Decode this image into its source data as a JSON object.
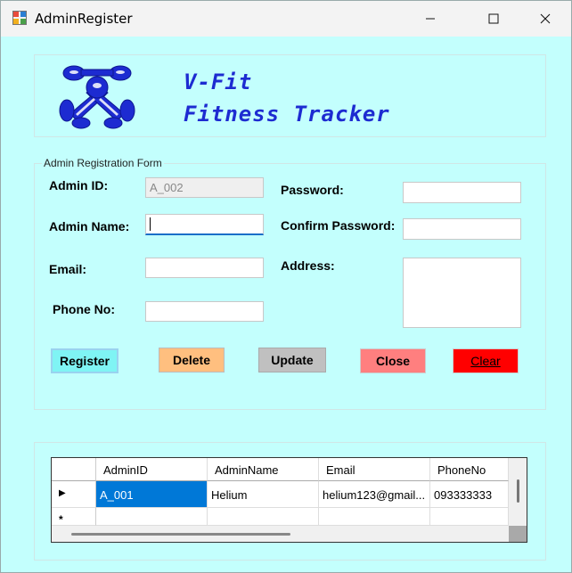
{
  "window": {
    "title": "AdminRegister",
    "icon": "winforms-app-icon",
    "controls": {
      "minimize": "minimize-icon",
      "maximize": "maximize-icon",
      "close": "close-icon"
    }
  },
  "header": {
    "logo_icon": "dumbbell-logo-icon",
    "line1": "V-Fit",
    "line2": "Fitness Tracker",
    "brand_color": "#1d2bd1"
  },
  "form": {
    "legend": "Admin Registration Form",
    "admin_id": {
      "label": "Admin ID:",
      "value": "A_002"
    },
    "admin_name": {
      "label": "Admin Name:",
      "value": ""
    },
    "email": {
      "label": "Email:",
      "value": ""
    },
    "phone": {
      "label": "Phone No:",
      "value": ""
    },
    "password": {
      "label": "Password:",
      "value": ""
    },
    "confirm_password": {
      "label": "Confirm Password:",
      "value": ""
    },
    "address": {
      "label": "Address:",
      "value": ""
    }
  },
  "buttons": {
    "register": {
      "label": "Register",
      "color": "#7ff4f4"
    },
    "delete": {
      "label": "Delete",
      "color": "#ffbf7f"
    },
    "update": {
      "label": "Update",
      "color": "#c0c0c0"
    },
    "close": {
      "label": "Close",
      "color": "#ff7f7f"
    },
    "clear": {
      "label": "Clear",
      "color": "#ff0000"
    }
  },
  "grid": {
    "columns": [
      "AdminID",
      "AdminName",
      "Email",
      "PhoneNo"
    ],
    "rows": [
      {
        "AdminID": "A_001",
        "AdminName": "Helium",
        "Email": "helium123@gmail...",
        "PhoneNo": "093333333"
      }
    ],
    "current_row_marker": "▶",
    "new_row_marker": "*"
  },
  "colors": {
    "background": "#c3fffd",
    "selection": "#0078d7"
  }
}
